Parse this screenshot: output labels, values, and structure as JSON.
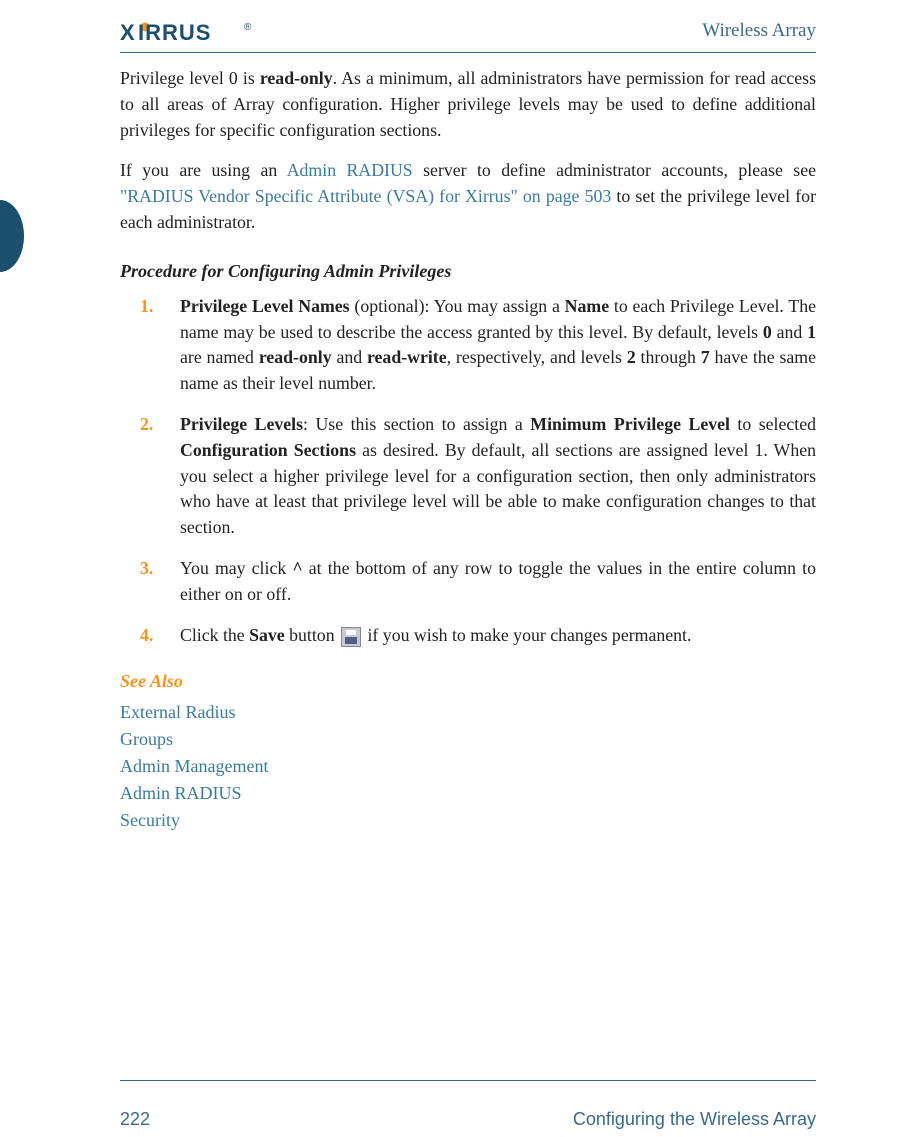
{
  "header": {
    "logo_text": "XIRRUS",
    "logo_fill": "#1a4f6e",
    "logo_dot": "#f7941d",
    "doc_name": "Wireless Array"
  },
  "intro": {
    "p1_a": "Privilege level 0 is ",
    "p1_b": "read-only",
    "p1_c": ". As a minimum, all administrators have permission for read access to all areas of Array configuration. Higher privilege levels may be used to define additional privileges for specific configuration sections.",
    "p2_a": "If you are using an ",
    "p2_link1": "Admin RADIUS",
    "p2_b": " server to define administrator accounts, please see ",
    "p2_link2": "\"RADIUS Vendor Specific Attribute (VSA) for Xirrus\" on page 503",
    "p2_c": " to set the privilege level for each administrator."
  },
  "procedure": {
    "heading": "Procedure for Configuring Admin Privileges",
    "items": [
      {
        "num": "1.",
        "lead": "Privilege Level Names",
        "a": " (optional): You may assign a ",
        "b1": "Name",
        "c": " to each Privilege Level. The name may be used to describe the access granted by this level. By default, levels ",
        "b2": "0",
        "d": " and ",
        "b3": "1",
        "e": " are named ",
        "b4": "read-only",
        "f": " and ",
        "b5": "read-write",
        "g": ", respectively, and levels ",
        "b6": "2",
        "h": " through ",
        "b7": "7",
        "i": " have the same name as their level number."
      },
      {
        "num": "2.",
        "lead": "Privilege Levels",
        "a": ": Use this section to assign a ",
        "b1": "Minimum Privilege Level",
        "c": " to selected ",
        "b2": "Configuration Sections",
        "d": " as desired. By default, all sections are assigned level 1. When you select a higher privilege level for a configuration section, then only administrators who have at least that privilege level will be able to make configuration changes to that section."
      },
      {
        "num": "3.",
        "a": "You may click ",
        "b1": "^",
        "c": " at the bottom of any row to toggle the values in the entire column to either on or off."
      },
      {
        "num": "4.",
        "a": "Click the ",
        "b1": "Save",
        "c": " button ",
        "d": " if you wish to make your changes permanent."
      }
    ]
  },
  "see_also": {
    "heading": "See Also",
    "links": [
      "External Radius",
      "Groups",
      "Admin Management",
      "Admin RADIUS",
      "Security"
    ]
  },
  "footer": {
    "page_num": "222",
    "section": "Configuring the Wireless Array"
  }
}
